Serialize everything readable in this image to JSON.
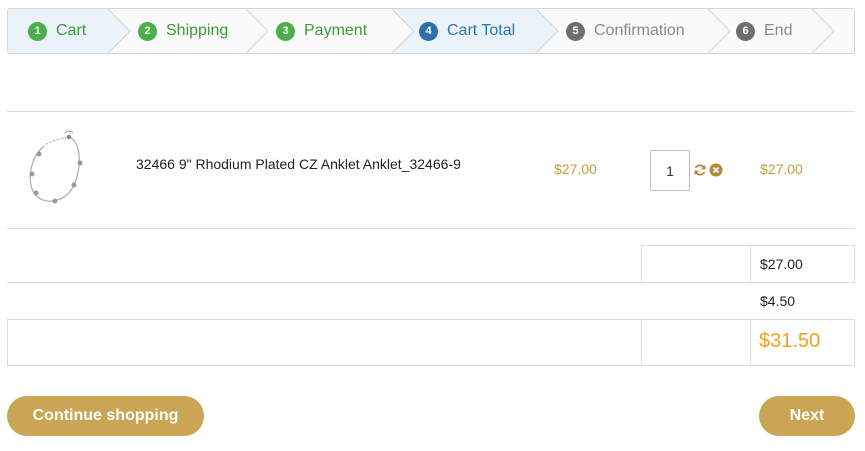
{
  "steps": [
    {
      "num": "1",
      "label": "Cart",
      "state": "done"
    },
    {
      "num": "2",
      "label": "Shipping",
      "state": "done"
    },
    {
      "num": "3",
      "label": "Payment",
      "state": "done"
    },
    {
      "num": "4",
      "label": "Cart Total",
      "state": "active"
    },
    {
      "num": "5",
      "label": "Confirmation",
      "state": "todo"
    },
    {
      "num": "6",
      "label": "End",
      "state": "todo"
    }
  ],
  "cart": {
    "items": [
      {
        "name": "32466 9\" Rhodium Plated CZ Anklet Anklet_32466-9",
        "unit_price": "$27.00",
        "quantity": "1",
        "line_total": "$27.00",
        "image_icon": "anklet-product-image"
      }
    ]
  },
  "totals": {
    "subtotal": "$27.00",
    "shipping": "$4.50",
    "grand_total": "$31.50"
  },
  "actions": {
    "continue_label": "Continue shopping",
    "next_label": "Next"
  },
  "colors": {
    "step_done": "#4cae4c",
    "step_active": "#2f6fa8",
    "step_todo": "#6e6e6e",
    "price_gold": "#c49a3b",
    "grand_total_orange": "#f0a020",
    "button_gold": "#c9a554"
  },
  "icons": {
    "update": "refresh-icon",
    "remove": "remove-circle-icon"
  }
}
